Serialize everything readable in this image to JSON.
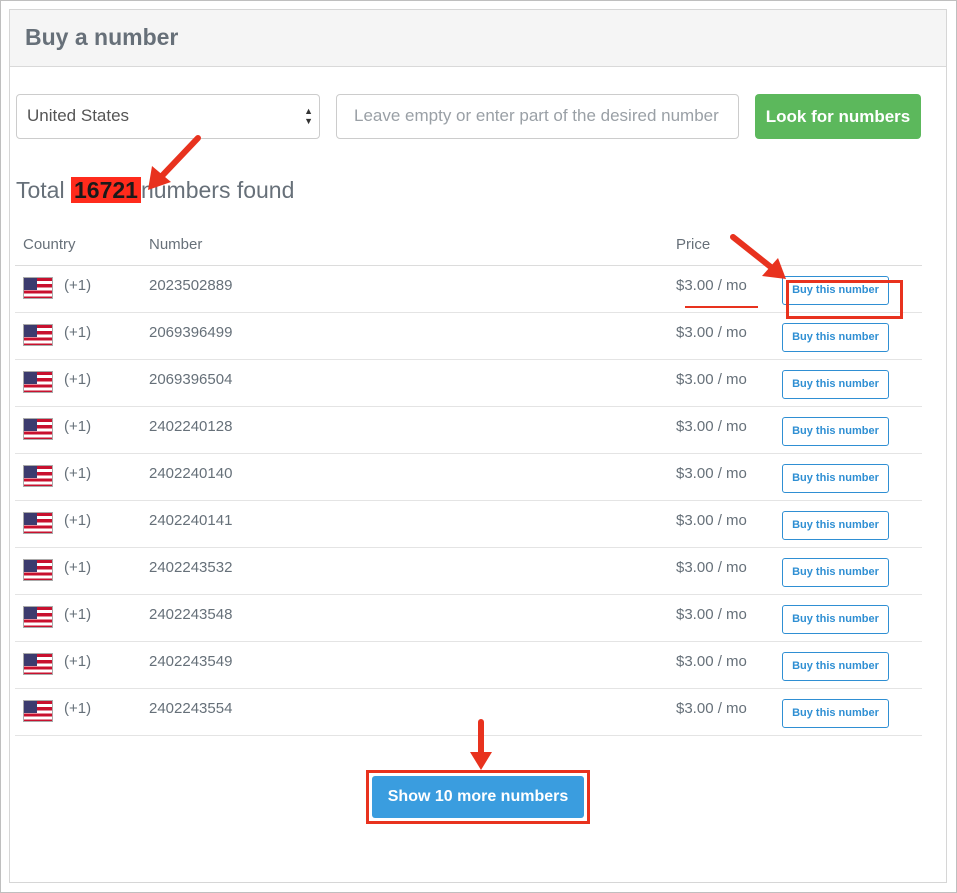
{
  "panel": {
    "title": "Buy a number"
  },
  "search": {
    "country": "United States",
    "number_placeholder": "Leave empty or enter part of the desired number",
    "look_button": "Look for numbers"
  },
  "results": {
    "prefix": "Total",
    "count": "16721",
    "suffix": "numbers found"
  },
  "table": {
    "headers": {
      "country": "Country",
      "number": "Number",
      "price": "Price"
    },
    "rows": [
      {
        "code": "(+1)",
        "number": "2023502889",
        "price": "$3.00 / mo",
        "button": "Buy this number"
      },
      {
        "code": "(+1)",
        "number": "2069396499",
        "price": "$3.00 / mo",
        "button": "Buy this number"
      },
      {
        "code": "(+1)",
        "number": "2069396504",
        "price": "$3.00 / mo",
        "button": "Buy this number"
      },
      {
        "code": "(+1)",
        "number": "2402240128",
        "price": "$3.00 / mo",
        "button": "Buy this number"
      },
      {
        "code": "(+1)",
        "number": "2402240140",
        "price": "$3.00 / mo",
        "button": "Buy this number"
      },
      {
        "code": "(+1)",
        "number": "2402240141",
        "price": "$3.00 / mo",
        "button": "Buy this number"
      },
      {
        "code": "(+1)",
        "number": "2402243532",
        "price": "$3.00 / mo",
        "button": "Buy this number"
      },
      {
        "code": "(+1)",
        "number": "2402243548",
        "price": "$3.00 / mo",
        "button": "Buy this number"
      },
      {
        "code": "(+1)",
        "number": "2402243549",
        "price": "$3.00 / mo",
        "button": "Buy this number"
      },
      {
        "code": "(+1)",
        "number": "2402243554",
        "price": "$3.00 / mo",
        "button": "Buy this number"
      }
    ]
  },
  "more_button": "Show 10 more numbers",
  "icons": {
    "flag": "us-flag-icon",
    "select": "chevron-up-down-icon",
    "annotation": "red-arrow-icon"
  },
  "colors": {
    "green_button": "#5cb85c",
    "blue_button": "#3a9ddf",
    "annotation_red": "#e8321e"
  }
}
